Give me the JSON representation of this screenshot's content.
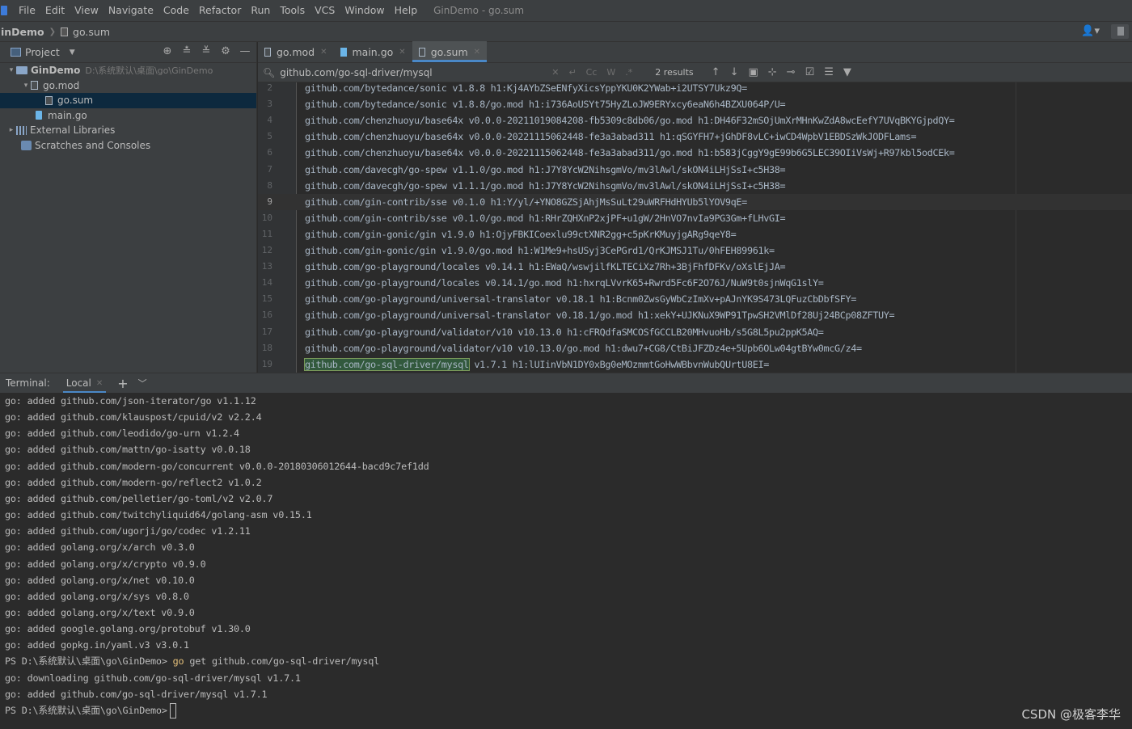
{
  "menubar": {
    "items": [
      "File",
      "Edit",
      "View",
      "Navigate",
      "Code",
      "Refactor",
      "Run",
      "Tools",
      "VCS",
      "Window",
      "Help"
    ],
    "window_title": "GinDemo - go.sum"
  },
  "navbar": {
    "project": "inDemo",
    "file": "go.sum"
  },
  "sidebar": {
    "title": "Project",
    "tree": [
      {
        "arrow": "▾",
        "icon": "folder",
        "label": "GinDemo",
        "path": "D:\\系统默认\\桌面\\go\\GinDemo",
        "indent": 8,
        "bold": true
      },
      {
        "arrow": "▾",
        "icon": "file",
        "label": "go.mod",
        "indent": 26
      },
      {
        "arrow": "",
        "icon": "file",
        "label": "go.sum",
        "indent": 44,
        "selected": true
      },
      {
        "arrow": "",
        "icon": "go",
        "label": "main.go",
        "indent": 32
      },
      {
        "arrow": "▸",
        "icon": "lib",
        "label": "External Libraries",
        "indent": 8
      },
      {
        "arrow": "",
        "icon": "scratch",
        "label": "Scratches and Consoles",
        "indent": 14
      }
    ]
  },
  "editor": {
    "tabs": [
      {
        "label": "go.mod",
        "icon": "file",
        "active": false
      },
      {
        "label": "main.go",
        "icon": "go",
        "active": false
      },
      {
        "label": "go.sum",
        "icon": "file",
        "active": true
      }
    ],
    "search": {
      "query": "github.com/go-sql-driver/mysql",
      "opt_case": "Cc",
      "opt_word": "W",
      "opt_regex": ".*",
      "results": "2 results"
    },
    "lines": [
      {
        "n": "2",
        "text": "github.com/bytedance/sonic v1.8.8 h1:Kj4AYbZSeENfyXicsYppYKU0K2YWab+i2UTSY7Ukz9Q="
      },
      {
        "n": "3",
        "text": "github.com/bytedance/sonic v1.8.8/go.mod h1:i736AoUSYt75HyZLoJW9ERYxcy6eaN6h4BZXU064P/U="
      },
      {
        "n": "4",
        "text": "github.com/chenzhuoyu/base64x v0.0.0-20211019084208-fb5309c8db06/go.mod h1:DH46F32mSOjUmXrMHnKwZdA8wcEefY7UVqBKYGjpdQY="
      },
      {
        "n": "5",
        "text": "github.com/chenzhuoyu/base64x v0.0.0-20221115062448-fe3a3abad311 h1:qSGYFH7+jGhDF8vLC+iwCD4WpbV1EBDSzWkJODFLams="
      },
      {
        "n": "6",
        "text": "github.com/chenzhuoyu/base64x v0.0.0-20221115062448-fe3a3abad311/go.mod h1:b583jCggY9gE99b6G5LEC39OIiVsWj+R97kbl5odCEk="
      },
      {
        "n": "7",
        "text": "github.com/davecgh/go-spew v1.1.0/go.mod h1:J7Y8YcW2NihsgmVo/mv3lAwl/skON4iLHjSsI+c5H38="
      },
      {
        "n": "8",
        "text": "github.com/davecgh/go-spew v1.1.1/go.mod h1:J7Y8YcW2NihsgmVo/mv3lAwl/skON4iLHjSsI+c5H38="
      },
      {
        "n": "9",
        "text": "github.com/gin-contrib/sse v0.1.0 h1:Y/yl/+YNO8GZSjAhjMsSuLt29uWRFHdHYUb5lYOV9qE=",
        "current": true
      },
      {
        "n": "10",
        "text": "github.com/gin-contrib/sse v0.1.0/go.mod h1:RHrZQHXnP2xjPF+u1gW/2HnVO7nvIa9PG3Gm+fLHvGI="
      },
      {
        "n": "11",
        "text": "github.com/gin-gonic/gin v1.9.0 h1:OjyFBKICoexlu99ctXNR2gg+c5pKrKMuyjgARg9qeY8="
      },
      {
        "n": "12",
        "text": "github.com/gin-gonic/gin v1.9.0/go.mod h1:W1Me9+hsUSyj3CePGrd1/QrKJMSJ1Tu/0hFEH89961k="
      },
      {
        "n": "13",
        "text": "github.com/go-playground/locales v0.14.1 h1:EWaQ/wswjilfKLTECiXz7Rh+3BjFhfDFKv/oXslEjJA="
      },
      {
        "n": "14",
        "text": "github.com/go-playground/locales v0.14.1/go.mod h1:hxrqLVvrK65+Rwrd5Fc6F2O76J/NuW9t0sjnWqG1slY="
      },
      {
        "n": "15",
        "text": "github.com/go-playground/universal-translator v0.18.1 h1:Bcnm0ZwsGyWbCzImXv+pAJnYK9S473LQFuzCbDbfSFY="
      },
      {
        "n": "16",
        "text": "github.com/go-playground/universal-translator v0.18.1/go.mod h1:xekY+UJKNuX9WP91TpwSH2VMlDf28Uj24BCp08ZFTUY="
      },
      {
        "n": "17",
        "text": "github.com/go-playground/validator/v10 v10.13.0 h1:cFRQdfaSMCOSfGCCLB20MHvuoHb/s5G8L5pu2ppK5AQ="
      },
      {
        "n": "18",
        "text": "github.com/go-playground/validator/v10 v10.13.0/go.mod h1:dwu7+CG8/CtBiJFZDz4e+5Upb6OLw04gtBYw0mcG/z4="
      },
      {
        "n": "19",
        "match": "github.com/go-sql-driver/mysql",
        "text": " v1.7.1 h1:lUIinVbN1DY0xBg0eMOzmmtGoHwWBbvnWubQUrtU8EI="
      }
    ]
  },
  "terminal": {
    "title": "Terminal:",
    "tab": "Local",
    "lines": [
      {
        "text": "go: added github.com/json-iterator/go v1.1.12"
      },
      {
        "text": "go: added github.com/klauspost/cpuid/v2 v2.2.4"
      },
      {
        "text": "go: added github.com/leodido/go-urn v1.2.4"
      },
      {
        "text": "go: added github.com/mattn/go-isatty v0.0.18"
      },
      {
        "text": "go: added github.com/modern-go/concurrent v0.0.0-20180306012644-bacd9c7ef1dd"
      },
      {
        "text": "go: added github.com/modern-go/reflect2 v1.0.2"
      },
      {
        "text": "go: added github.com/pelletier/go-toml/v2 v2.0.7"
      },
      {
        "text": "go: added github.com/twitchyliquid64/golang-asm v0.15.1"
      },
      {
        "text": "go: added github.com/ugorji/go/codec v1.2.11"
      },
      {
        "text": "go: added golang.org/x/arch v0.3.0"
      },
      {
        "text": "go: added golang.org/x/crypto v0.9.0"
      },
      {
        "text": "go: added golang.org/x/net v0.10.0"
      },
      {
        "text": "go: added golang.org/x/sys v0.8.0"
      },
      {
        "text": "go: added golang.org/x/text v0.9.0"
      },
      {
        "text": "go: added google.golang.org/protobuf v1.30.0"
      },
      {
        "text": "go: added gopkg.in/yaml.v3 v3.0.1"
      },
      {
        "prompt": "PS D:\\系统默认\\桌面\\go\\GinDemo> ",
        "cmd": "go",
        "text": " get github.com/go-sql-driver/mysql"
      },
      {
        "text": "go: downloading github.com/go-sql-driver/mysql v1.7.1"
      },
      {
        "text": "go: added github.com/go-sql-driver/mysql v1.7.1"
      },
      {
        "prompt": "PS D:\\系统默认\\桌面\\go\\GinDemo>",
        "cursor": true
      }
    ]
  },
  "watermark": "CSDN @极客李华"
}
